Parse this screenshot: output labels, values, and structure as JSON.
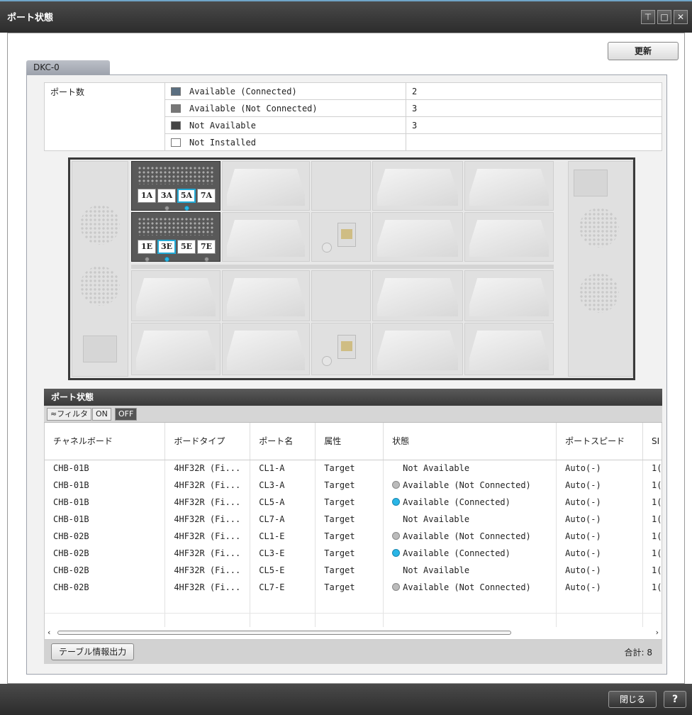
{
  "window": {
    "title": "ポート状態",
    "buttons": [
      "pin",
      "maximize",
      "close"
    ]
  },
  "toolbar": {
    "refresh_label": "更新"
  },
  "tab": {
    "label": "DKC-0"
  },
  "port_counts": {
    "label": "ポート数",
    "rows": [
      {
        "status": "Available (Connected)",
        "count": "2",
        "icon": "connected-port-icon"
      },
      {
        "status": "Available (Not Connected)",
        "count": "3",
        "icon": "not-connected-port-icon"
      },
      {
        "status": "Not Available",
        "count": "3",
        "icon": "not-available-port-icon"
      },
      {
        "status": "Not Installed",
        "count": "",
        "icon": "not-installed-port-icon"
      }
    ]
  },
  "chassis": {
    "board_a_ports": [
      "1A",
      "3A",
      "5A",
      "7A"
    ],
    "board_a_connected": [
      false,
      false,
      true,
      false
    ],
    "board_e_ports": [
      "1E",
      "3E",
      "5E",
      "7E"
    ],
    "board_e_connected": [
      false,
      true,
      false,
      false
    ]
  },
  "status_list": {
    "title": "ポート状態",
    "filter": {
      "label": "≈フィルタ",
      "on": "ON",
      "off": "OFF"
    },
    "columns": [
      "チャネルボード",
      "ボードタイプ",
      "ポート名",
      "属性",
      "状態",
      "ポートスピード",
      "SI 速"
    ],
    "rows": [
      {
        "board": "CHB-01B",
        "type": "4HF32R (Fi...",
        "port": "CL1-A",
        "attr": "Target",
        "status": "Not Available",
        "dot": "none",
        "speed": "Auto(-)",
        "extra": "1("
      },
      {
        "board": "CHB-01B",
        "type": "4HF32R (Fi...",
        "port": "CL3-A",
        "attr": "Target",
        "status": "Available (Not Connected)",
        "dot": "gray",
        "speed": "Auto(-)",
        "extra": "1("
      },
      {
        "board": "CHB-01B",
        "type": "4HF32R (Fi...",
        "port": "CL5-A",
        "attr": "Target",
        "status": "Available (Connected)",
        "dot": "blue",
        "speed": "Auto(-)",
        "extra": "1("
      },
      {
        "board": "CHB-01B",
        "type": "4HF32R (Fi...",
        "port": "CL7-A",
        "attr": "Target",
        "status": "Not Available",
        "dot": "none",
        "speed": "Auto(-)",
        "extra": "1("
      },
      {
        "board": "CHB-02B",
        "type": "4HF32R (Fi...",
        "port": "CL1-E",
        "attr": "Target",
        "status": "Available (Not Connected)",
        "dot": "gray",
        "speed": "Auto(-)",
        "extra": "1("
      },
      {
        "board": "CHB-02B",
        "type": "4HF32R (Fi...",
        "port": "CL3-E",
        "attr": "Target",
        "status": "Available (Connected)",
        "dot": "blue",
        "speed": "Auto(-)",
        "extra": "1("
      },
      {
        "board": "CHB-02B",
        "type": "4HF32R (Fi...",
        "port": "CL5-E",
        "attr": "Target",
        "status": "Not Available",
        "dot": "none",
        "speed": "Auto(-)",
        "extra": "1("
      },
      {
        "board": "CHB-02B",
        "type": "4HF32R (Fi...",
        "port": "CL7-E",
        "attr": "Target",
        "status": "Available (Not Connected)",
        "dot": "gray",
        "speed": "Auto(-)",
        "extra": "1("
      }
    ],
    "export_label": "テーブル情報出力",
    "total_label": "合計:",
    "total_value": "8"
  },
  "footer": {
    "close_label": "閉じる",
    "help_label": "?"
  }
}
